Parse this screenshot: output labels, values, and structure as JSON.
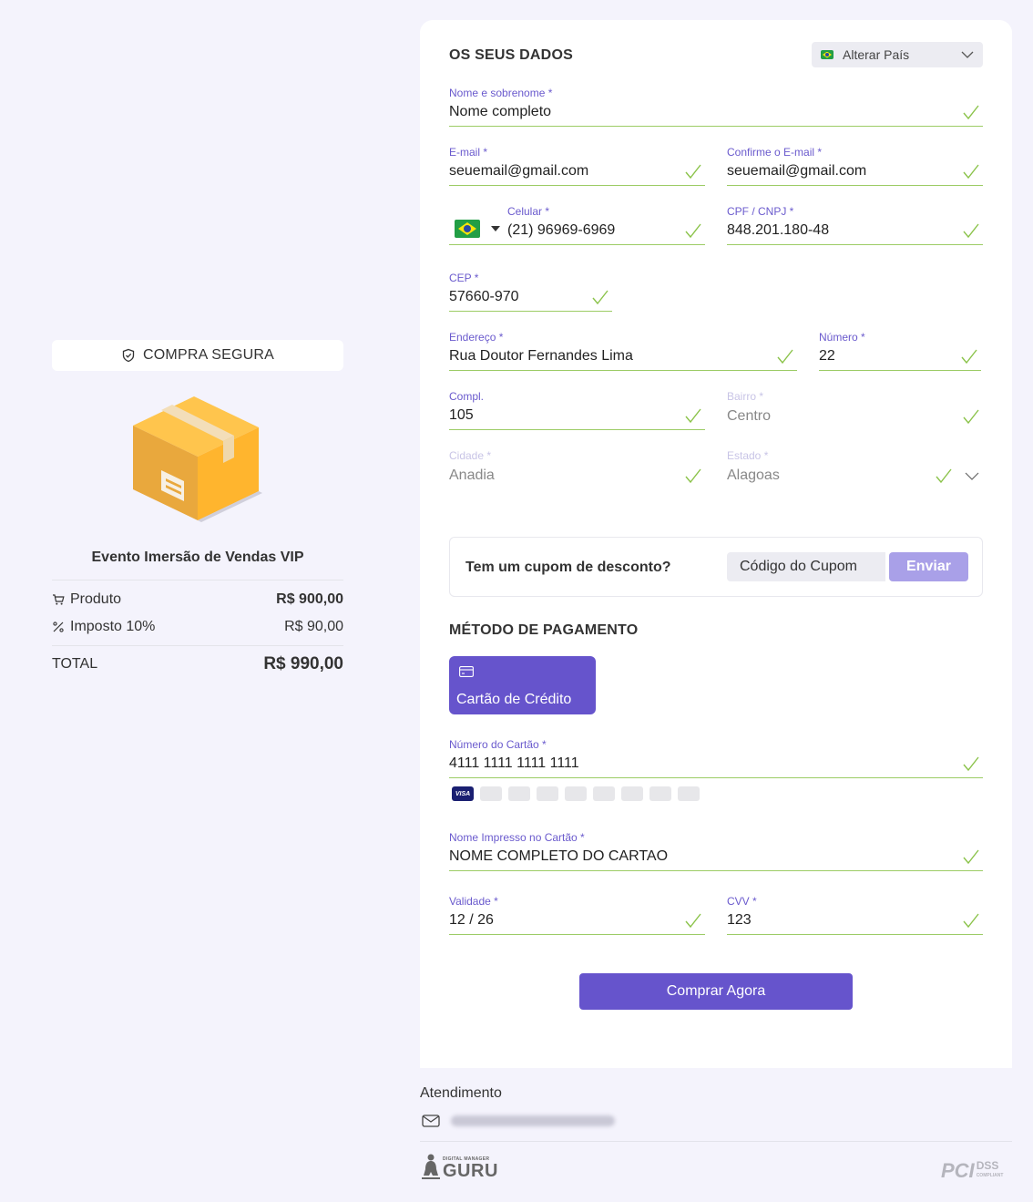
{
  "summary": {
    "secure_label": "COMPRA SEGURA",
    "product_name": "Evento Imersão de Vendas VIP",
    "rows": [
      {
        "label": "Produto",
        "value": "R$ 900,00"
      },
      {
        "label": "Imposto 10%",
        "value": "R$ 90,00"
      }
    ],
    "total_label": "TOTAL",
    "total_value": "R$ 990,00"
  },
  "form": {
    "title": "OS SEUS DADOS",
    "country_button": "Alterar País",
    "name": {
      "label": "Nome e sobrenome *",
      "value": "Nome completo"
    },
    "email": {
      "label": "E-mail *",
      "value": "seuemail@gmail.com"
    },
    "email_confirm": {
      "label": "Confirme o E-mail *",
      "value": "seuemail@gmail.com"
    },
    "phone": {
      "label": "Celular *",
      "value": "(21) 96969-6969"
    },
    "cpf": {
      "label": "CPF / CNPJ *",
      "value": "848.201.180-48"
    },
    "cep": {
      "label": "CEP *",
      "value": "57660-970"
    },
    "address": {
      "label": "Endereço *",
      "value": "Rua Doutor Fernandes Lima"
    },
    "number": {
      "label": "Número *",
      "value": "22"
    },
    "compl": {
      "label": "Compl.",
      "value": "105"
    },
    "bairro": {
      "label": "Bairro *",
      "value": "Centro"
    },
    "cidade": {
      "label": "Cidade *",
      "value": "Anadia"
    },
    "estado": {
      "label": "Estado *",
      "value": "Alagoas"
    }
  },
  "coupon": {
    "question": "Tem um cupom de desconto?",
    "placeholder": "Código do Cupom",
    "send_label": "Enviar"
  },
  "payment": {
    "title": "MÉTODO DE PAGAMENTO",
    "method_label": "Cartão de Crédito",
    "card_number": {
      "label": "Número do Cartão *",
      "value": "4111 1111 1111 1111"
    },
    "card_name": {
      "label": "Nome Impresso no Cartão *",
      "value": "NOME COMPLETO DO CARTAO"
    },
    "validity": {
      "label": "Validade *",
      "value": "12 / 26"
    },
    "cvv": {
      "label": "CVV *",
      "value": "123"
    },
    "brands": [
      "VISA",
      "mastercard",
      "amex",
      "diners",
      "discover",
      "jcb",
      "elo",
      "hipercard",
      "aura"
    ],
    "buy_label": "Comprar Agora"
  },
  "footer": {
    "support_title": "Atendimento",
    "logo_small": "DIGITAL MANAGER",
    "logo_big": "GURU",
    "pci": "PCI",
    "dss": "DSS",
    "dss_sub": "COMPLIANT"
  },
  "colors": {
    "accent": "#6654cc",
    "valid": "#9ccc65",
    "label": "#6a5acd"
  }
}
